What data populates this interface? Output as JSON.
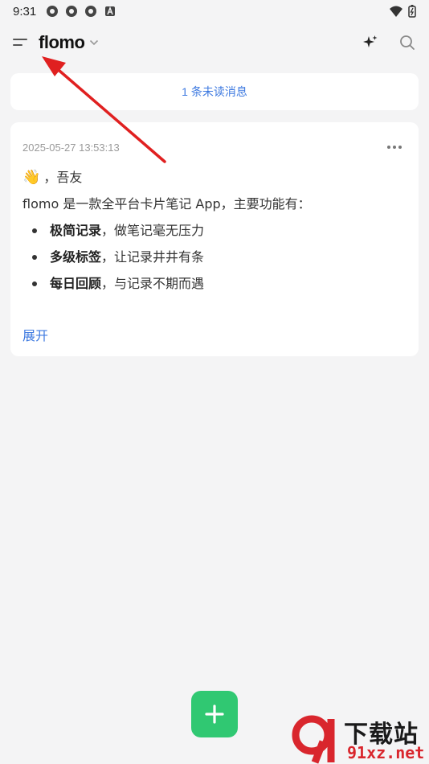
{
  "status_bar": {
    "time": "9:31"
  },
  "header": {
    "brand": "flomo"
  },
  "unread_banner": {
    "text": "1 条未读消息"
  },
  "memo": {
    "timestamp": "2025-05-27 13:53:13",
    "greeting_emoji": "👋",
    "greeting_text": "，吾友",
    "intro": "flomo 是一款全平台卡片笔记 App，主要功能有：",
    "features": [
      {
        "bold": "极简记录",
        "rest": "，做笔记毫无压力"
      },
      {
        "bold": "多级标签",
        "rest": "，让记录井井有条"
      },
      {
        "bold": "每日回顾",
        "rest": "，与记录不期而遇"
      }
    ],
    "expand_label": "展开"
  },
  "watermark": {
    "text": "下载站",
    "url": "91xz.net"
  },
  "colors": {
    "accent_blue": "#3d79e0",
    "fab_green": "#30c872",
    "annotation_red": "#e02020",
    "background": "#f4f4f5"
  }
}
